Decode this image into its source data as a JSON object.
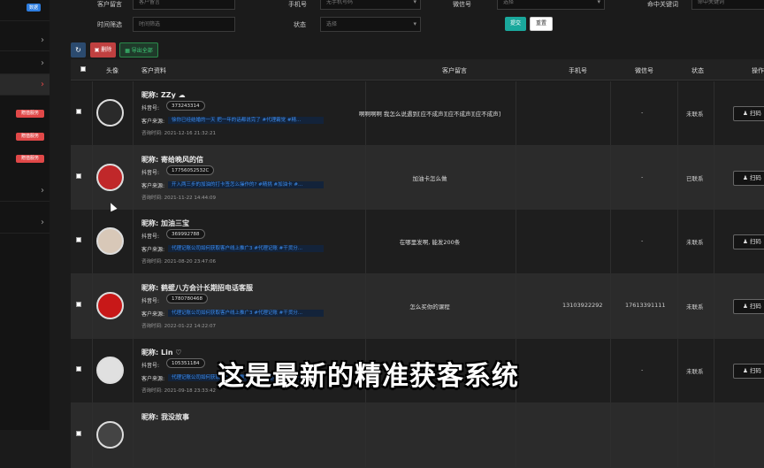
{
  "sidebar": {
    "badge": "数据",
    "tags": [
      "赠值服务",
      "赠值服务",
      "赠值服务"
    ]
  },
  "filters": {
    "customer_msg_label": "客户留言",
    "customer_msg_placeholder": "客户留言",
    "phone_label": "手机号",
    "phone_placeholder": "无手机号码",
    "wechat_label": "微信号",
    "wechat_value": "选择",
    "keyword_label": "命中关键词",
    "keyword_placeholder": "命中关键词",
    "time_label": "时间筛选",
    "time_placeholder": "时间筛选",
    "status_label": "状态",
    "status_value": "选择",
    "submit_label": "提交",
    "reset_label": "重置"
  },
  "toolbar": {
    "refresh_icon": "refresh-icon",
    "delete_label": "删除",
    "export_label": "导出全部"
  },
  "table": {
    "headers": {
      "avatar": "头像",
      "profile": "客户资料",
      "message": "客户留言",
      "phone": "手机号",
      "wechat": "微信号",
      "status": "状态",
      "action": "操作"
    },
    "labels": {
      "douyin": "抖音号:",
      "source": "客户来源:",
      "inquiry_time": "咨询时间:",
      "action_btn": "扫码"
    },
    "rows": [
      {
        "nickname": "昵称: ZZy ☁",
        "douyin": "373243314",
        "source": "徐你已经结婚的一天 把一年的话都说完了 #代理霸觉 #精...",
        "time": "咨询时间: 2021-12-16 21:32:21",
        "message": "啊啊啊啊 我怎么说遇到[应不成声][应不成声][应不成声]",
        "phone": "",
        "wechat": "-",
        "status": "未联系"
      },
      {
        "nickname": "昵称: 寄给晚风的信",
        "douyin": "17756052532C",
        "source": "开入两三步的加油的打卡签怎么操作的? #精挑 #加油卡 #...",
        "time": "咨询时间: 2021-11-22 14:44:09",
        "message": "加油卡怎么做",
        "phone": "",
        "wechat": "-",
        "status": "已联系"
      },
      {
        "nickname": "昵称: 加油三宝",
        "douyin": "369992788",
        "source": "代理记账公司如何获取客户线上推广3 #代理记账 #干货分...",
        "time": "咨询时间: 2021-08-20 23:47:06",
        "message": "在哪里发啊, 能发200条",
        "phone": "",
        "wechat": "-",
        "status": "未联系"
      },
      {
        "nickname": "昵称: 鹤壁八方会计长期招电话客服",
        "douyin": "1780780468",
        "source": "代理记账公司如何获取客户线上推广3 #代理记账 #干货分...",
        "time": "咨询时间: 2022-01-22 14:22:07",
        "message": "怎么买你的课程",
        "phone": "13103922292",
        "wechat": "17613391111",
        "status": "未联系"
      },
      {
        "nickname": "昵称: Lin ♡",
        "douyin": "105351184",
        "source": "代理记账公司如何获取客户线上推广3 #代理记账 #干货分...",
        "time": "咨询时间: 2021-09-18 23:33:42",
        "message": "",
        "phone": "",
        "wechat": "-",
        "status": "未联系"
      },
      {
        "nickname": "昵称: 我没故事",
        "douyin": "",
        "source": "",
        "time": "",
        "message": "",
        "phone": "",
        "wechat": "",
        "status": ""
      }
    ]
  },
  "caption": "这是最新的精准获客系统",
  "colors": {
    "submit": "#1aa89c",
    "delete": "#c04040",
    "export": "#2a8a4a",
    "link": "#3d8ef0"
  }
}
